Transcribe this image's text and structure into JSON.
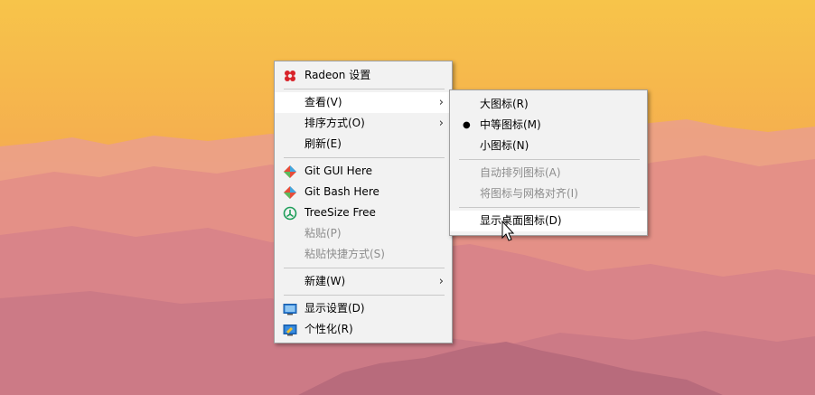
{
  "context_menu": {
    "items": [
      {
        "label": "Radeon 设置",
        "icon": "radeon-icon"
      },
      {
        "label": "查看(V)",
        "submenu": true
      },
      {
        "label": "排序方式(O)",
        "submenu": true
      },
      {
        "label": "刷新(E)"
      },
      {
        "label": "Git GUI Here",
        "icon": "git-icon"
      },
      {
        "label": "Git Bash Here",
        "icon": "git-icon"
      },
      {
        "label": "TreeSize Free",
        "icon": "treesize-icon"
      },
      {
        "label": "粘贴(P)",
        "disabled": true
      },
      {
        "label": "粘贴快捷方式(S)",
        "disabled": true
      },
      {
        "label": "新建(W)",
        "submenu": true
      },
      {
        "label": "显示设置(D)",
        "icon": "display-icon"
      },
      {
        "label": "个性化(R)",
        "icon": "personalize-icon"
      }
    ],
    "submenu_arrow": "›"
  },
  "view_submenu": {
    "items": [
      {
        "label": "大图标(R)"
      },
      {
        "label": "中等图标(M)",
        "checked": true
      },
      {
        "label": "小图标(N)"
      },
      {
        "label": "自动排列图标(A)",
        "disabled": true
      },
      {
        "label": "将图标与网格对齐(I)",
        "disabled": true
      },
      {
        "label": "显示桌面图标(D)",
        "highlighted": true
      }
    ],
    "bullet": "●"
  },
  "colors": {
    "sky_top": "#f6b84a",
    "sky_bottom": "#f19a6b",
    "mountains_far": "#e79a86",
    "mountains_mid": "#d9868a",
    "mountains_near": "#c77a85",
    "menu_bg": "#f2f2f2",
    "highlight": "#ffffff",
    "disabled_text": "#8d8d8d"
  }
}
